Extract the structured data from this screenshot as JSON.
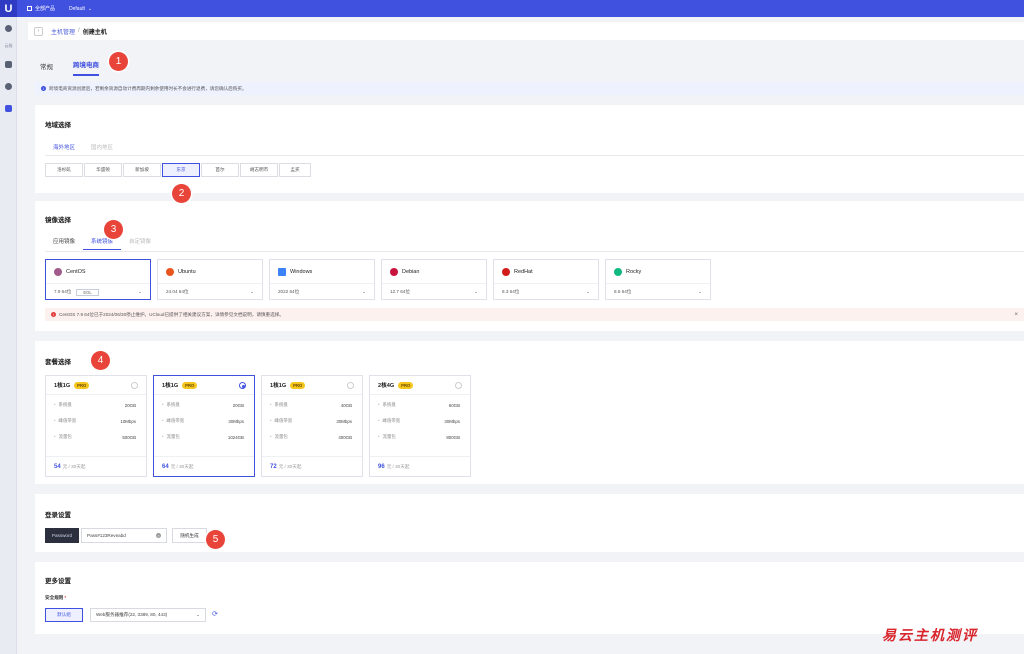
{
  "topbar": {
    "logo": "U",
    "product_label": "全部产品",
    "project_label": "Default"
  },
  "rail": {
    "label": "云服"
  },
  "breadcrumb": {
    "parent": "主机管理",
    "sep": "/",
    "current": "创建主机"
  },
  "main_tabs": [
    {
      "label": "常规"
    },
    {
      "label": "跨境电商"
    }
  ],
  "notice": "跨境电商资源创建后，若剩余资源自动计费周期内剩余使用时长不会进行退费，请您确认后购买。",
  "region": {
    "title": "地域选择",
    "tabs": [
      {
        "label": "海外地区"
      },
      {
        "label": "国内地区"
      }
    ],
    "items": [
      "洛杉矶",
      "华盛顿",
      "新加坡",
      "东京",
      "首尔",
      "胡志明市",
      "孟买"
    ]
  },
  "image": {
    "title": "镜像选择",
    "tabs": [
      {
        "label": "应用镜像"
      },
      {
        "label": "系统镜像"
      },
      {
        "label": "自定镜像"
      }
    ],
    "os": [
      {
        "name": "CentOS",
        "version": "7.9 64位",
        "badge": "EOL",
        "color": "#a05a8c"
      },
      {
        "name": "Ubuntu",
        "version": "24.04 64位",
        "color": "#e9541f"
      },
      {
        "name": "Windows",
        "version": "2022 64位",
        "color": "#3b82f6"
      },
      {
        "name": "Debian",
        "version": "12.7 64位",
        "color": "#c8143c"
      },
      {
        "name": "RedHat",
        "version": "8.3 64位",
        "color": "#d21b1b"
      },
      {
        "name": "Rocky",
        "version": "8.5 64位",
        "color": "#10b981"
      }
    ],
    "warning": "CentOS 7.9 64位已于2024/06/30停止维护。UCloud已提供了相关建议方案，详情参见文档说明，请慎重选择。",
    "warning_close": "×"
  },
  "plans": {
    "title": "套餐选择",
    "badge": "PRO",
    "keys": {
      "disk": "系统盘",
      "bandwidth": "峰值带宽",
      "traffic": "流量包"
    },
    "price_unit": "元 / 30天起",
    "items": [
      {
        "name": "1核1G",
        "disk": "20GB",
        "bandwidth": "10Mbps",
        "traffic": "500GB",
        "price": "54"
      },
      {
        "name": "1核1G",
        "disk": "20GB",
        "bandwidth": "30Mbps",
        "traffic": "1024GB",
        "price": "64"
      },
      {
        "name": "1核1G",
        "disk": "40GB",
        "bandwidth": "30Mbps",
        "traffic": "400GB",
        "price": "72"
      },
      {
        "name": "2核4G",
        "disk": "60GB",
        "bandwidth": "30Mbps",
        "traffic": "800GB",
        "price": "96"
      }
    ]
  },
  "login": {
    "title": "登录设置",
    "key_button": "Password",
    "password": "Pass#123Reveabd",
    "clear": "×",
    "generate": "随机生成"
  },
  "more": {
    "title": "更多设置",
    "sg_label": "安全规则",
    "sg_required": "*",
    "sg_tag": "默认组",
    "sg_value": "Web服务器推荐(22, 3389, 80, 443)",
    "refresh": "⟳"
  },
  "markers": [
    "1",
    "2",
    "3",
    "4",
    "5"
  ],
  "watermark": "易云主机测评"
}
